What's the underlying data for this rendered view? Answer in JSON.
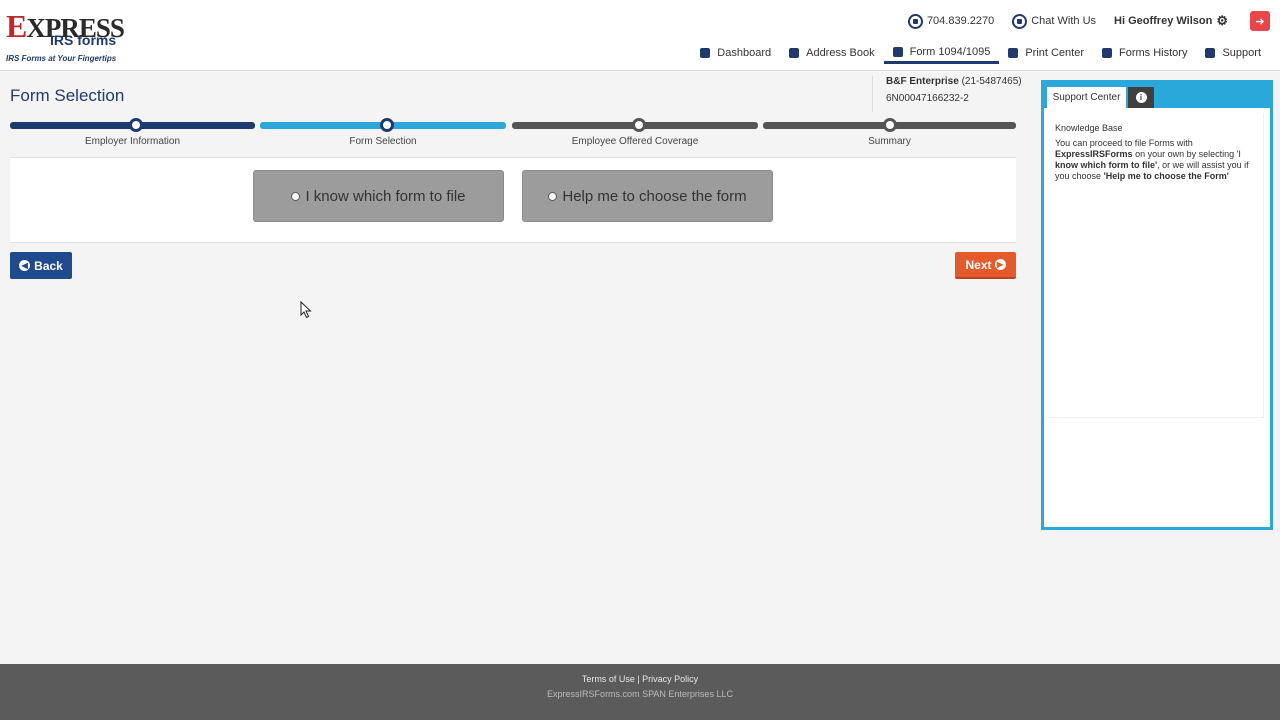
{
  "logo": {
    "brand_x": "E",
    "brand_rest": "XPRESS",
    "brand_sub": "IRS forms",
    "tagline": "IRS Forms at Your Fingertips"
  },
  "topbar": {
    "phone": "704.839.2270",
    "chat": "Chat With Us",
    "greeting": "Hi Geoffrey Wilson"
  },
  "nav": {
    "items": [
      {
        "label": "Dashboard"
      },
      {
        "label": "Address Book"
      },
      {
        "label": "Form 1094/1095"
      },
      {
        "label": "Print Center"
      },
      {
        "label": "Forms History"
      },
      {
        "label": "Support"
      }
    ],
    "active_index": 2
  },
  "page": {
    "title": "Form Selection"
  },
  "employer": {
    "name": "B&F Enterprise",
    "ein": "(21-5487465)",
    "id": "6N00047166232-2"
  },
  "steps": [
    {
      "label": "Employer Information",
      "status": "complete"
    },
    {
      "label": "Form Selection",
      "status": "current"
    },
    {
      "label": "Employee Offered Coverage",
      "status": "pending"
    },
    {
      "label": "Summary",
      "status": "pending"
    }
  ],
  "choices": {
    "option1": "I know which form to file",
    "option2": "Help me to choose the form"
  },
  "buttons": {
    "back": "Back",
    "next": "Next"
  },
  "support": {
    "tab_label": "Support Center",
    "kb_title": "Knowledge Base",
    "kb_text_1": "You can proceed to file Forms with",
    "kb_brand": "ExpressIRSForms",
    "kb_text_2": "on your own by selecting 'I",
    "kb_bold_1": "know which form to file'",
    "kb_text_3": ", or we will assist you if you choose",
    "kb_bold_2": "'Help me to choose the Form'"
  },
  "footer": {
    "links": "Terms of Use | Privacy Policy",
    "copyright_1": "ExpressIRSForms.com",
    "copyright_2": "SPAN Enterprises LLC"
  },
  "colors": {
    "primary": "#1f3a6e",
    "accent": "#29a8d9",
    "next": "#e55a2b",
    "footer": "#5b5b5b"
  }
}
